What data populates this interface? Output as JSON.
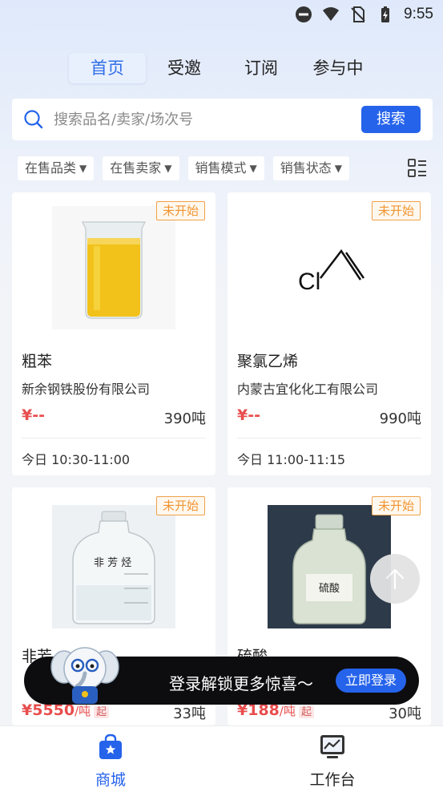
{
  "status_bar": {
    "time": "9:55",
    "icons": [
      "dnd-icon",
      "wifi-icon",
      "no-sim-icon",
      "battery-charging-icon"
    ]
  },
  "tabs": [
    {
      "label": "首页",
      "active": true
    },
    {
      "label": "受邀",
      "active": false
    },
    {
      "label": "订阅",
      "active": false
    },
    {
      "label": "参与中",
      "active": false
    }
  ],
  "search": {
    "placeholder": "搜索品名/卖家/场次号",
    "button_label": "搜索"
  },
  "filters": [
    {
      "label": "在售品类"
    },
    {
      "label": "在售卖家"
    },
    {
      "label": "销售模式"
    },
    {
      "label": "销售状态"
    }
  ],
  "products": [
    {
      "status": "未开始",
      "name": "粗苯",
      "seller": "新余钢铁股份有限公司",
      "price": "¥--",
      "quantity": "390吨",
      "time": "今日 10:30-11:00",
      "image": "beaker-yellow-liquid"
    },
    {
      "status": "未开始",
      "name": "聚氯乙烯",
      "seller": "内蒙古宜化化工有限公司",
      "price": "¥--",
      "quantity": "990吨",
      "time": "今日 11:00-11:15",
      "image": "vinyl-chloride-structure",
      "structure_label": "Cl"
    },
    {
      "status": "未开始",
      "name_partial": "非芳",
      "price": "¥5550",
      "price_unit": "/吨",
      "price_tag": "起",
      "quantity": "33吨",
      "image": "bottle-non-aromatic",
      "bottle_label": "非 芳 烃"
    },
    {
      "status": "未开始",
      "name_partial": "硫酸",
      "price": "¥188",
      "price_unit": "/吨",
      "price_tag": "起",
      "quantity": "30吨",
      "image": "bottle-sulfuric-acid",
      "bottle_label": "硫酸"
    }
  ],
  "login_banner": {
    "text": "登录解锁更多惊喜～",
    "button_label": "立即登录"
  },
  "bottom_nav": [
    {
      "label": "商城",
      "active": true,
      "icon": "shop-bag-icon"
    },
    {
      "label": "工作台",
      "active": false,
      "icon": "workbench-monitor-icon"
    }
  ],
  "colors": {
    "accent": "#2563eb",
    "price": "#e84d4d",
    "badge": "#f09532",
    "active_tab_bg": "#e9f0fd"
  }
}
